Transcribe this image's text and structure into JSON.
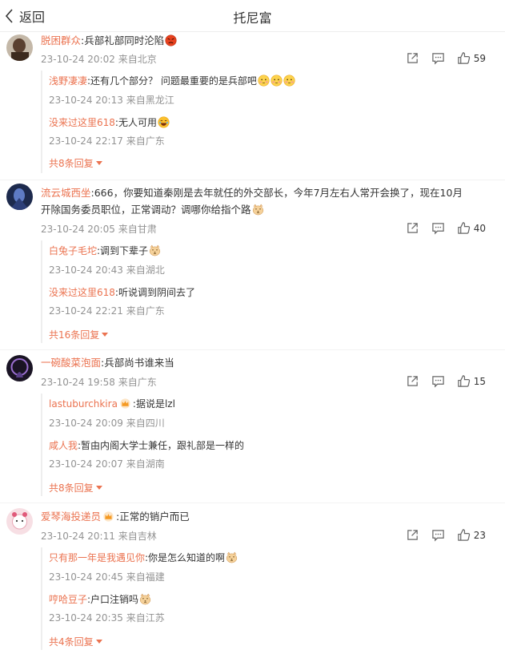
{
  "header": {
    "back_label": "返回",
    "title": "托尼富"
  },
  "comments": [
    {
      "user": "脱困群众",
      "text": ":兵部礼部同时沦陷",
      "time": "23-10-24 20:02",
      "location": "来自北京",
      "likes": "59",
      "replies": [
        {
          "user": "浅野凄凄",
          "text": ":还有几个部分？ 问题最重要的是兵部吧",
          "time": "23-10-24 20:13",
          "location": "来自黑龙江"
        },
        {
          "user": "没来过这里618",
          "text": ":无人可用",
          "time": "23-10-24 22:17",
          "location": "来自广东"
        }
      ],
      "more": "共8条回复"
    },
    {
      "user": "流云城西坐",
      "text": ":666，你要知道秦刚是去年就任的外交部长，今年7月左右人常开会换了，现在10月",
      "text2": "开除国务委员职位，正常调动？调哪你给指个路",
      "time": "23-10-24 20:05",
      "location": "来自甘肃",
      "likes": "40",
      "replies": [
        {
          "user": "白兔子毛坨",
          "text": ":调到下辈子",
          "time": "23-10-24 20:43",
          "location": "来自湖北"
        },
        {
          "user": "没来过这里618",
          "text": ":听说调到阴间去了",
          "time": "23-10-24 22:21",
          "location": "来自广东"
        }
      ],
      "more": "共16条回复"
    },
    {
      "user": "一碗酸菜泡面",
      "text": ":兵部尚书谁来当",
      "time": "23-10-24 19:58",
      "location": "来自广东",
      "likes": "15",
      "replies": [
        {
          "user": "lastuburchkira",
          "text": ":据说是lzl",
          "time": "23-10-24 20:09",
          "location": "来自四川"
        },
        {
          "user": "咸人我",
          "text": ":暂由内阁大学士兼任，跟礼部是一样的",
          "time": "23-10-24 20:07",
          "location": "来自湖南"
        }
      ],
      "more": "共8条回复"
    },
    {
      "user": "爱琴海投递员",
      "text": ":正常的销户而已",
      "time": "23-10-24 20:11",
      "location": "来自吉林",
      "likes": "23",
      "replies": [
        {
          "user": "只有那一年是我遇见你",
          "text": ":你是怎么知道的啊",
          "time": "23-10-24 20:45",
          "location": "来自福建"
        },
        {
          "user": "哼哈豆子",
          "text": ":户口注销吗",
          "time": "23-10-24 20:35",
          "location": "来自江苏"
        }
      ],
      "more": "共4条回复"
    }
  ],
  "colors": {
    "username": "#eb7350",
    "meta": "#939393",
    "text": "#333333"
  }
}
